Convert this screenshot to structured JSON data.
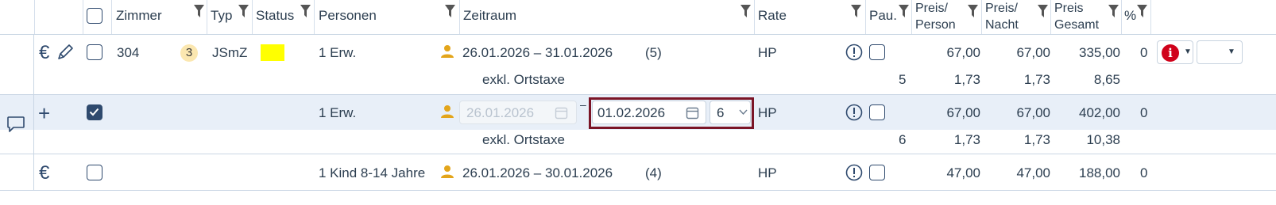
{
  "header": {
    "zimmer": "Zimmer",
    "typ": "Typ",
    "status": "Status",
    "personen": "Personen",
    "zeitraum": "Zeitraum",
    "rate": "Rate",
    "pau": "Pau.",
    "preis_person_1": "Preis/",
    "preis_person_2": "Person",
    "preis_nacht_1": "Preis/",
    "preis_nacht_2": "Nacht",
    "preis_gesamt_1": "Preis",
    "preis_gesamt_2": "Gesamt",
    "percent": "%"
  },
  "rows": [
    {
      "zimmer": "304",
      "badge": "3",
      "typ": "JSmZ",
      "status_color": "#ffff00",
      "personen": "1 Erw.",
      "zeitraum": "26.01.2026 – 31.01.2026",
      "nights": "(5)",
      "rate": "HP",
      "preis_person": "67,00",
      "preis_nacht": "67,00",
      "preis_gesamt": "335,00",
      "percent": "0",
      "sub_label": "exkl. Ortstaxe",
      "sub_count": "5",
      "sub_person": "1,73",
      "sub_nacht": "1,73",
      "sub_gesamt": "8,65"
    },
    {
      "personen": "1 Erw.",
      "date_from": "26.01.2026",
      "dash": "–",
      "date_to": "01.02.2026",
      "nights_select": "6",
      "rate": "HP",
      "preis_person": "67,00",
      "preis_nacht": "67,00",
      "preis_gesamt": "402,00",
      "percent": "0",
      "sub_label": "exkl. Ortstaxe",
      "sub_count": "6",
      "sub_person": "1,73",
      "sub_nacht": "1,73",
      "sub_gesamt": "10,38"
    },
    {
      "personen": "1 Kind 8-14 Jahre",
      "zeitraum": "26.01.2026 – 30.01.2026",
      "nights": "(4)",
      "rate": "HP",
      "preis_person": "47,00",
      "preis_nacht": "47,00",
      "preis_gesamt": "188,00",
      "percent": "0"
    }
  ],
  "icons": {
    "euro": "€",
    "plus": "+"
  },
  "colors": {
    "highlight": "#7a1426",
    "selected_row": "#e8eff8",
    "info_red": "#d0021b",
    "status_yellow": "#ffff00"
  }
}
